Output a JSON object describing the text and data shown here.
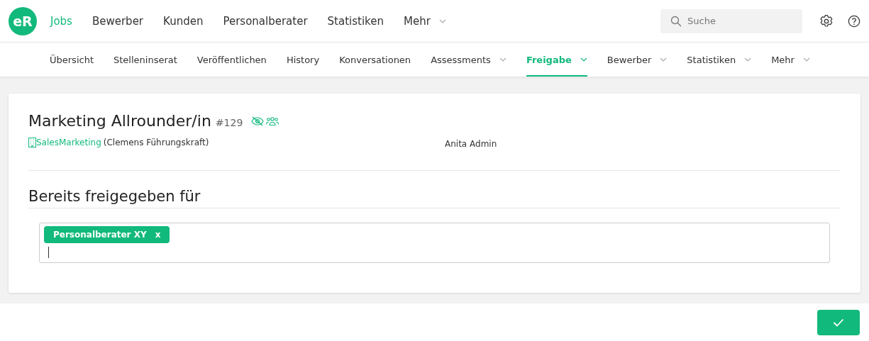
{
  "logo": {
    "text": "eR"
  },
  "main_nav": [
    {
      "label": "Jobs",
      "selected": true,
      "dropdown": false
    },
    {
      "label": "Bewerber",
      "selected": false,
      "dropdown": false
    },
    {
      "label": "Kunden",
      "selected": false,
      "dropdown": false
    },
    {
      "label": "Personalberater",
      "selected": false,
      "dropdown": false
    },
    {
      "label": "Statistiken",
      "selected": false,
      "dropdown": false
    },
    {
      "label": "Mehr",
      "selected": false,
      "dropdown": true
    }
  ],
  "search": {
    "placeholder": "Suche"
  },
  "sub_nav": [
    {
      "label": "Übersicht",
      "selected": false,
      "dropdown": false
    },
    {
      "label": "Stelleninserat",
      "selected": false,
      "dropdown": false
    },
    {
      "label": "Veröffentlichen",
      "selected": false,
      "dropdown": false
    },
    {
      "label": "History",
      "selected": false,
      "dropdown": false
    },
    {
      "label": "Konversationen",
      "selected": false,
      "dropdown": false
    },
    {
      "label": "Assessments",
      "selected": false,
      "dropdown": true
    },
    {
      "label": "Freigabe",
      "selected": true,
      "dropdown": true
    },
    {
      "label": "Bewerber",
      "selected": false,
      "dropdown": true
    },
    {
      "label": "Statistiken",
      "selected": false,
      "dropdown": true
    },
    {
      "label": "Mehr",
      "selected": false,
      "dropdown": true
    }
  ],
  "job": {
    "title": "Marketing Allrounder/in",
    "number": "#129",
    "company": "SalesMarketing",
    "contact": "(Clemens Führungskraft)",
    "owner": "Anita Admin"
  },
  "shared_section": {
    "heading": "Bereits freigegeben für",
    "tags": [
      {
        "label": "Personalberater XY",
        "remove": "x"
      }
    ]
  }
}
